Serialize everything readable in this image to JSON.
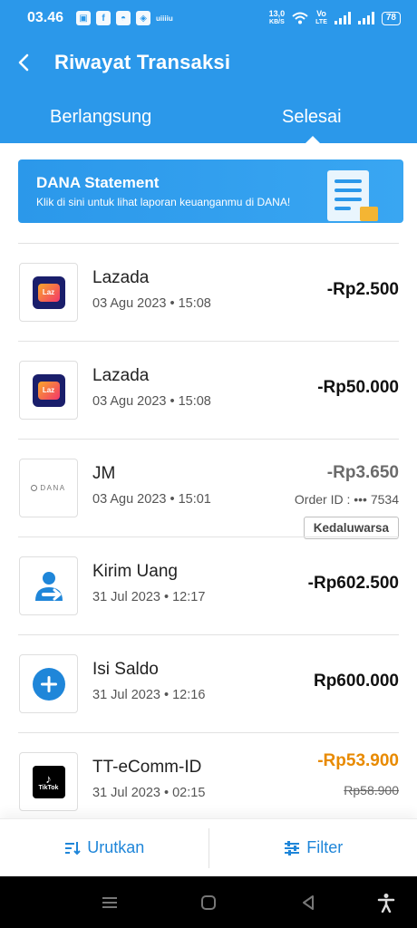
{
  "status_bar": {
    "time": "03.46",
    "icons": [
      "shopping-bag-icon",
      "facebook-icon",
      "android-icon",
      "shield-icon"
    ],
    "small_text": "uiiiiu",
    "speed_value": "13,0",
    "speed_unit": "KB/S",
    "network_label_1": "Vo",
    "network_label_2": "LTE",
    "battery": "78"
  },
  "header": {
    "title": "Riwayat Transaksi",
    "tabs": [
      {
        "label": "Berlangsung",
        "active": false
      },
      {
        "label": "Selesai",
        "active": true
      }
    ]
  },
  "banner": {
    "title": "DANA Statement",
    "subtitle": "Klik di sini untuk lihat laporan keuanganmu di DANA!"
  },
  "transactions": [
    {
      "name": "Lazada",
      "date": "03 Agu 2023 • 15:08",
      "amount": "-Rp2.500",
      "icon": "lazada-logo"
    },
    {
      "name": "Lazada",
      "date": "03 Agu 2023 • 15:08",
      "amount": "-Rp50.000",
      "icon": "lazada-logo"
    },
    {
      "name": "JM",
      "date": "03 Agu 2023 • 15:01",
      "amount": "-Rp3.650",
      "order_id": "Order ID : ••• 7534",
      "badge": "Kedaluwarsa",
      "icon": "dana-logo",
      "logo_text": "DANA"
    },
    {
      "name": "Kirim Uang",
      "date": "31 Jul 2023 • 12:17",
      "amount": "-Rp602.500",
      "icon": "send-money-icon"
    },
    {
      "name": "Isi Saldo",
      "date": "31 Jul 2023 • 12:16",
      "amount": "Rp600.000",
      "icon": "plus-circle-icon"
    },
    {
      "name": "TT-eComm-ID",
      "date": "31 Jul 2023 • 02:15",
      "amount": "-Rp53.900",
      "original_amount": "Rp58.900",
      "icon": "tiktok-logo",
      "logo_text": "TikTok"
    }
  ],
  "bottom_bar": {
    "sort_label": "Urutkan",
    "filter_label": "Filter"
  },
  "colors": {
    "primary": "#2b98ea",
    "accent_text": "#1f86d9",
    "discount": "#e88a00"
  }
}
